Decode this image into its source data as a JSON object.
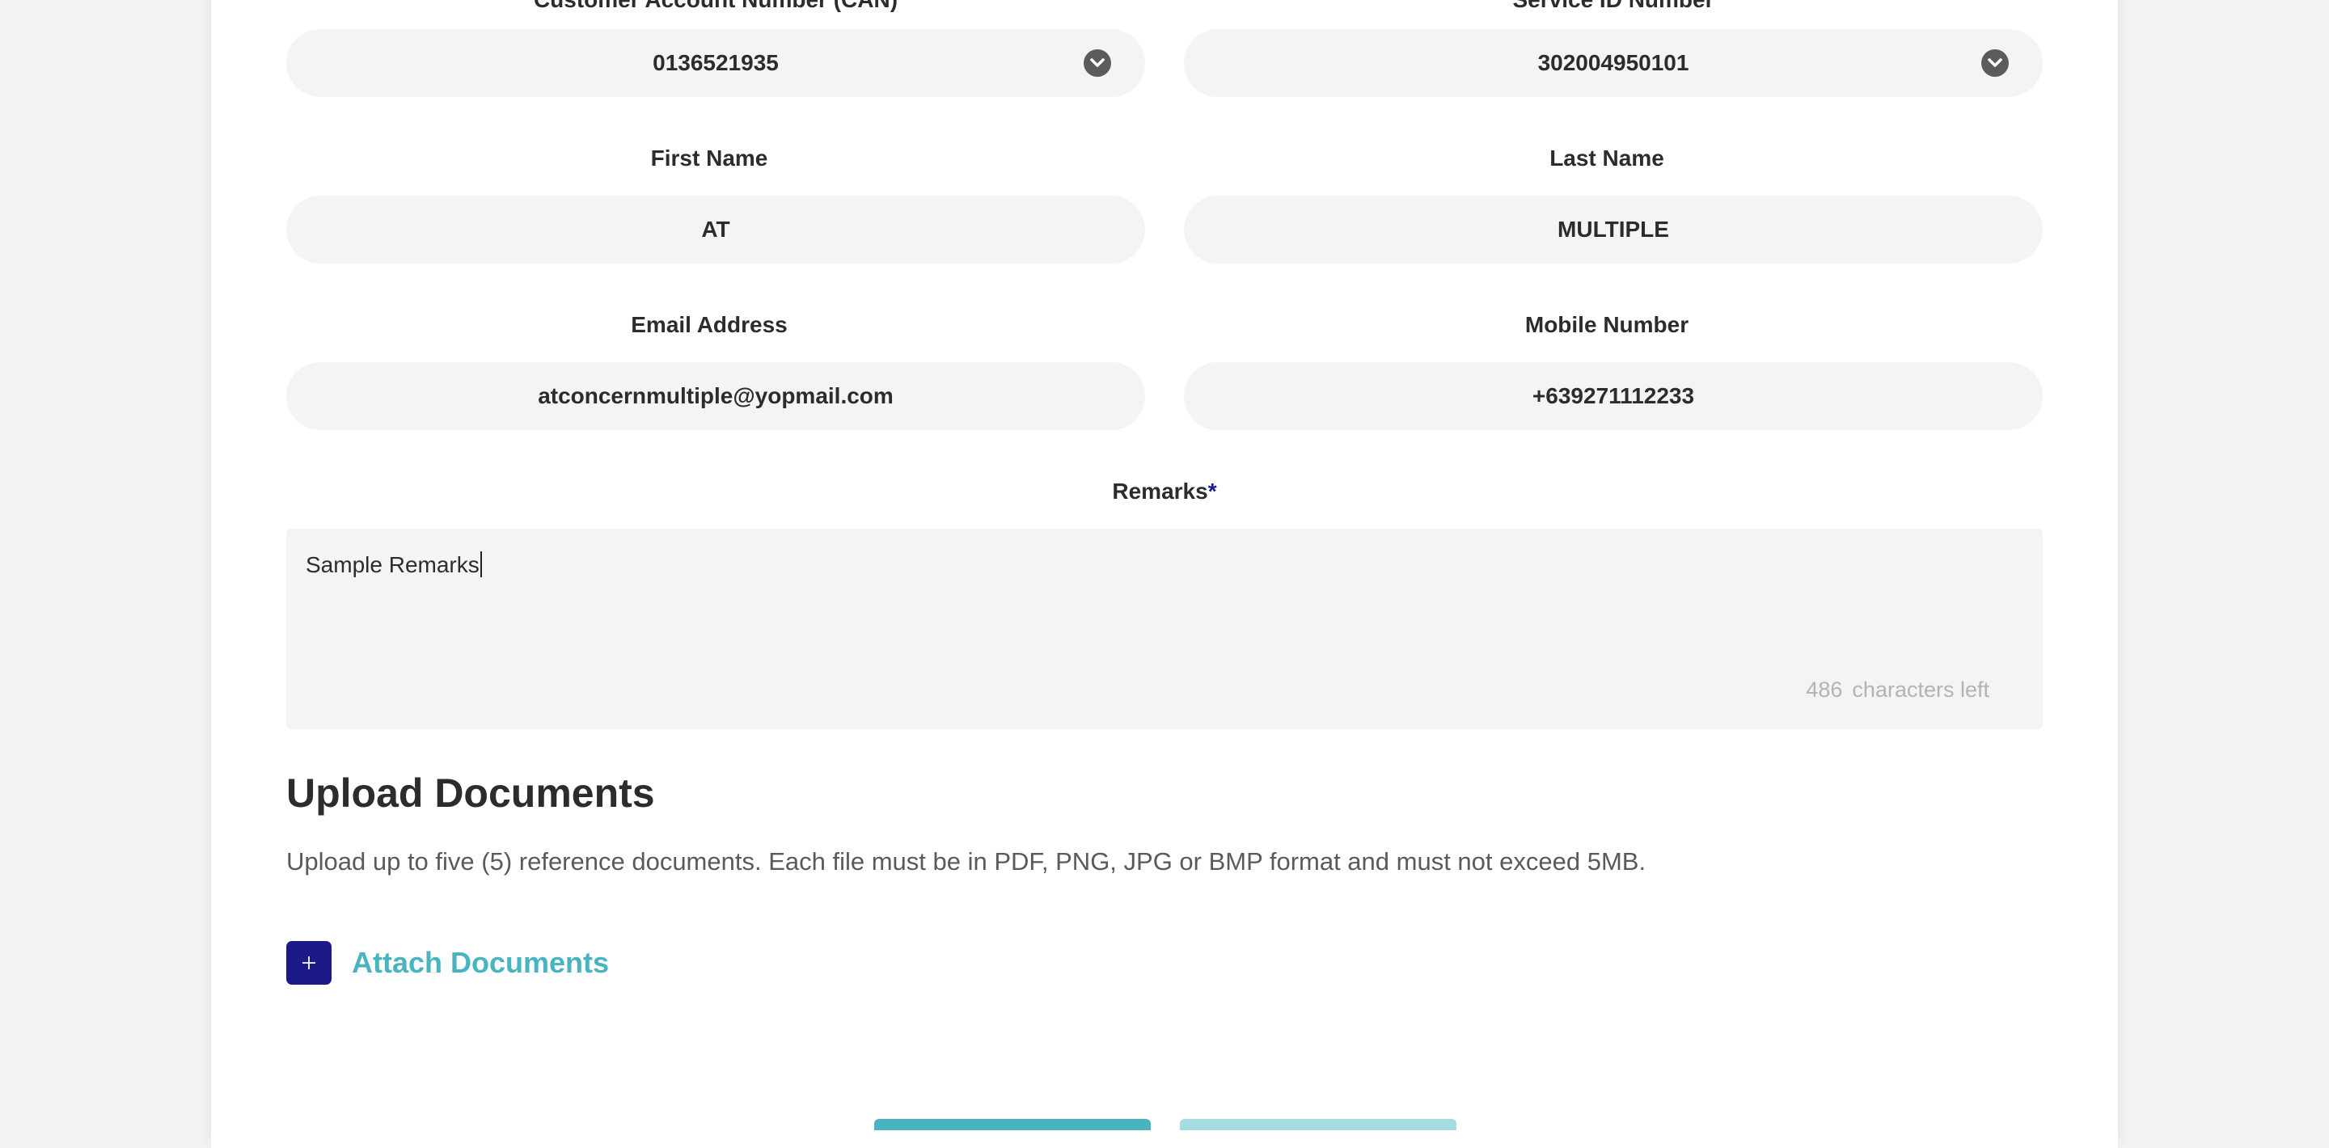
{
  "form": {
    "can_label": "Customer Account Number (CAN)",
    "can_value": "0136521935",
    "service_id_label": "Service ID Number",
    "service_id_value": "302004950101",
    "first_name_label": "First Name",
    "first_name_value": "AT",
    "last_name_label": "Last Name",
    "last_name_value": "MULTIPLE",
    "email_label": "Email Address",
    "email_value": "atconcernmultiple@yopmail.com",
    "mobile_label": "Mobile Number",
    "mobile_value": "+639271112233",
    "remarks_label": "Remarks",
    "remarks_required_mark": "*",
    "remarks_value": "Sample Remarks",
    "chars_left_count": "486",
    "chars_left_text": "characters left"
  },
  "upload": {
    "heading": "Upload Documents",
    "description": "Upload up to five (5) reference documents. Each file must be in PDF, PNG, JPG or BMP format and must not exceed 5MB.",
    "attach_label": "Attach Documents",
    "attach_icon": "plus-icon"
  },
  "icons": {
    "dropdown": "chevron-down-circle-icon"
  },
  "colors": {
    "accent_navy": "#1b1a88",
    "link_teal": "#49b3bf",
    "field_bg": "#f4f4f4",
    "button_primary": "#49b3bf",
    "button_disabled": "#a6dbe0"
  }
}
